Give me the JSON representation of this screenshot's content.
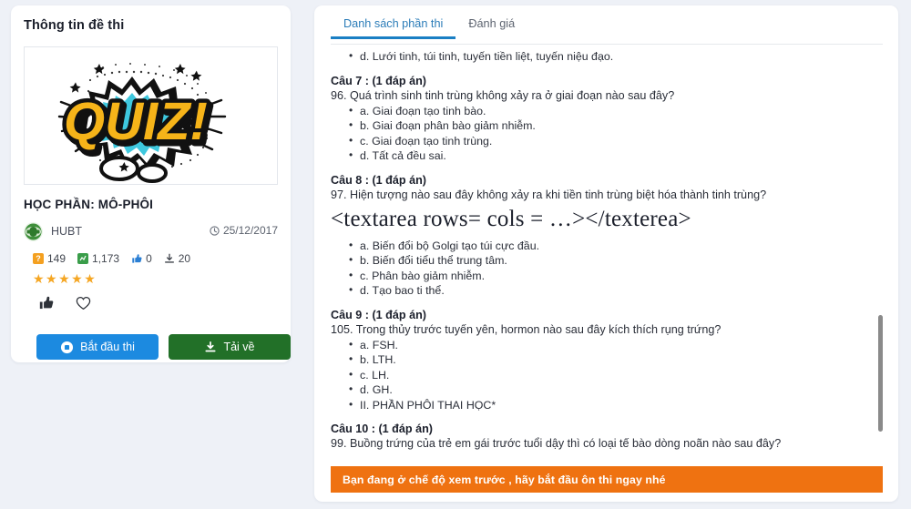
{
  "left_panel": {
    "title": "Thông tin đề thi",
    "thumbnail_alt": "QUIZ!",
    "thumbnail_text": "QUIZ!",
    "subject": "HỌC PHẦN: MÔ-PHÔI",
    "author": "HUBT",
    "date": "25/12/2017",
    "stats": [
      {
        "icon": "question-badge-icon",
        "value": "149"
      },
      {
        "icon": "document-badge-icon",
        "value": "1,173"
      },
      {
        "icon": "thumbs-up-icon",
        "value": "0"
      },
      {
        "icon": "download-icon",
        "value": "20"
      }
    ],
    "rating_stars": "★★★★★",
    "rating_value": 5,
    "reactions": [
      {
        "icon": "thumbs-up-icon"
      },
      {
        "icon": "heart-icon"
      }
    ],
    "buttons": {
      "start": {
        "label": "Bắt đầu thi",
        "icon": "play-circle-icon",
        "color": "#1c8ae0"
      },
      "download": {
        "label": "Tải về",
        "icon": "download-icon",
        "color": "#227028"
      }
    }
  },
  "right_panel": {
    "tabs": [
      {
        "label": "Danh sách phần thi",
        "active": true
      },
      {
        "label": "Đánh giá",
        "active": false
      }
    ],
    "blocks": [
      {
        "type": "answers",
        "items": [
          "d. Lưới tinh, túi tinh, tuyến tiền liệt, tuyến niệu đạo."
        ]
      },
      {
        "type": "question",
        "head": "Câu 7 : (1 đáp án)",
        "text": "96. Quá trình sinh tinh trùng không xảy ra ở giai đoạn nào sau đây?",
        "items": [
          "a. Giai đoạn tạo tinh bào.",
          "b. Giai đoạn phân bào giảm nhiễm.",
          "c. Giai đoạn tạo tinh trùng.",
          "d. Tất cả đều sai."
        ]
      },
      {
        "type": "question",
        "head": "Câu 8 : (1 đáp án)",
        "text": "97. Hiện tượng nào sau đây không xảy ra khi tiền tinh trùng biệt hóa thành tinh trùng?",
        "serif_line": "<textarea rows= cols =  …></texterea>",
        "items": [
          "a. Biến đổi bộ Golgi tạo túi cực đầu.",
          "b. Biến đổi tiểu thể trung tâm.",
          "c. Phân bào giảm nhiễm.",
          "d. Tạo bao ti thể."
        ]
      },
      {
        "type": "question",
        "head": "Câu 9 : (1 đáp án)",
        "text": "105. Trong thủy trước tuyến yên, hormon nào sau đây kích thích rụng trứng?",
        "items": [
          "a. FSH.",
          "b. LTH.",
          "c. LH.",
          "d. GH.",
          "II. PHẦN PHÔI THAI HỌC*"
        ]
      },
      {
        "type": "question",
        "head": "Câu 10 : (1 đáp án)",
        "text": "99. Buồng trứng của trẻ em gái trước tuổi dậy thì có loại tế bào dòng noãn nào sau đây?",
        "items": []
      }
    ],
    "notice": "Bạn đang ở chế độ xem trước , hãy bắt đầu ôn thi ngay nhé",
    "notice_color": "#ef7211"
  }
}
